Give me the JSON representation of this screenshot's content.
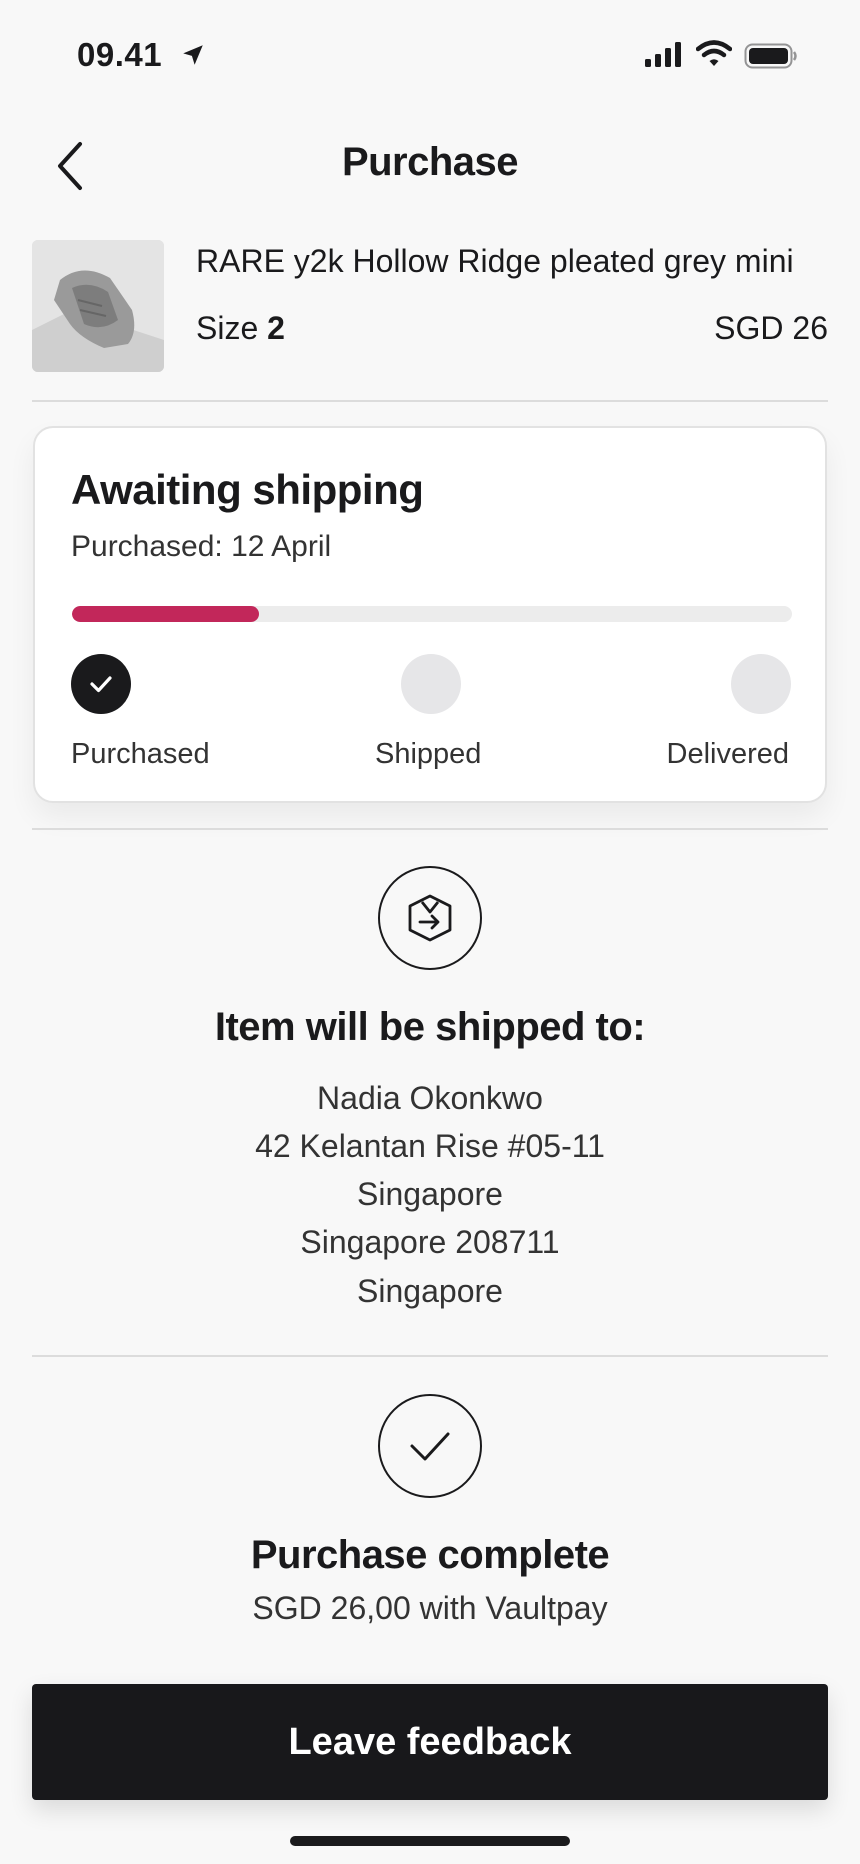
{
  "status_bar": {
    "time": "09.41"
  },
  "nav": {
    "title": "Purchase"
  },
  "item": {
    "title": "RARE y2k Hollow Ridge pleated grey mini",
    "size_label": "Size",
    "size_value": "2",
    "price": "SGD 26"
  },
  "shipping_status": {
    "title": "Awaiting shipping",
    "purchased_date": "Purchased: 12 April",
    "progress": 0.26,
    "progress_color": "#c2275a",
    "steps": [
      {
        "label": "Purchased",
        "done": true
      },
      {
        "label": "Shipped",
        "done": false
      },
      {
        "label": "Delivered",
        "done": false
      }
    ]
  },
  "shipping_address": {
    "icon": "package-arrow-icon",
    "heading": "Item will be shipped to:",
    "lines": [
      "Nadia Okonkwo",
      "42 Kelantan Rise #05-11",
      "Singapore",
      "Singapore 208711",
      "Singapore"
    ]
  },
  "payment": {
    "icon": "check-icon",
    "heading": "Purchase complete",
    "detail": "SGD 26,00 with Vaultpay"
  },
  "actions": {
    "feedback_label": "Leave feedback"
  }
}
